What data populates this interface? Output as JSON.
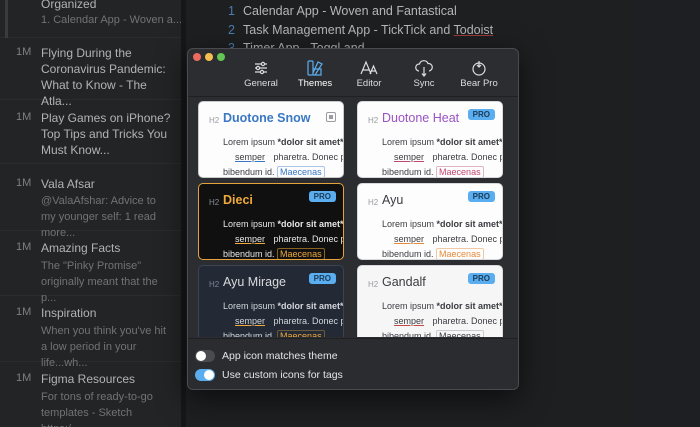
{
  "notes_list": {
    "first_partial": {
      "title": "Organized",
      "preview": "1. Calendar App - Woven a..."
    },
    "items": [
      {
        "age": "1M",
        "title": "Flying During the Coronavirus Pandemic: What to Know - The Atla...",
        "preview": ""
      },
      {
        "age": "1M",
        "title": "Play Games on iPhone? Top Tips and Tricks You Must Know...",
        "preview": ""
      },
      {
        "age": "1M",
        "title": "Vala Afsar",
        "preview": "@ValaAfshar: Advice to my younger self: 1 read more..."
      },
      {
        "age": "1M",
        "title": "Amazing Facts",
        "preview": "The \"Pinky Promise\" originally meant that the p..."
      },
      {
        "age": "1M",
        "title": "Inspiration",
        "preview": "When you think you've hit a low period in your life...wh..."
      },
      {
        "age": "1M",
        "title": "Figma Resources",
        "preview": "For tons of ready-to-go templates - Sketch https:/..."
      }
    ]
  },
  "editor": {
    "lines": [
      {
        "num": "1",
        "text_before": "Calendar App - Woven and Fantastical",
        "underlined": ""
      },
      {
        "num": "2",
        "text_before": "Task Management App - TickTick and ",
        "underlined": "Todoist"
      },
      {
        "num": "3",
        "text_before": "Timer App - Toggl and",
        "underlined": ""
      }
    ]
  },
  "preferences": {
    "toolbar": [
      {
        "label": "General",
        "icon": "sliders-icon"
      },
      {
        "label": "Themes",
        "icon": "swatches-icon"
      },
      {
        "label": "Editor",
        "icon": "text-size-icon"
      },
      {
        "label": "Sync",
        "icon": "cloud-sync-icon"
      },
      {
        "label": "Bear Pro",
        "icon": "bear-pro-icon"
      }
    ],
    "active_tab": "Themes",
    "sample": {
      "heading_tag": "H2",
      "line1_plain": "Lorem ipsum ",
      "line1_bold": "*dolor sit amet*",
      "line2_underlined": "semper",
      "line2_rest": " pharetra. Donec po",
      "line3_plain": "bibendum id. ",
      "line3_tag": "Maecenas"
    },
    "themes": [
      {
        "name": "Duotone Snow",
        "badge": "",
        "name_color": "#3a78c4"
      },
      {
        "name": "Duotone Heat",
        "badge": "PRO",
        "name_color": "#9a52c4"
      },
      {
        "name": "Dieci",
        "badge": "PRO",
        "name_color": "#f0a93a"
      },
      {
        "name": "Ayu",
        "badge": "PRO",
        "name_color": "#3b3c40"
      },
      {
        "name": "Ayu Mirage",
        "badge": "PRO",
        "name_color": "#d9dadc"
      },
      {
        "name": "Gandalf",
        "badge": "PRO",
        "name_color": "#3b3c40"
      }
    ],
    "options": [
      {
        "label": "App icon matches theme",
        "enabled": false
      },
      {
        "label": "Use custom icons for tags",
        "enabled": true
      }
    ]
  }
}
